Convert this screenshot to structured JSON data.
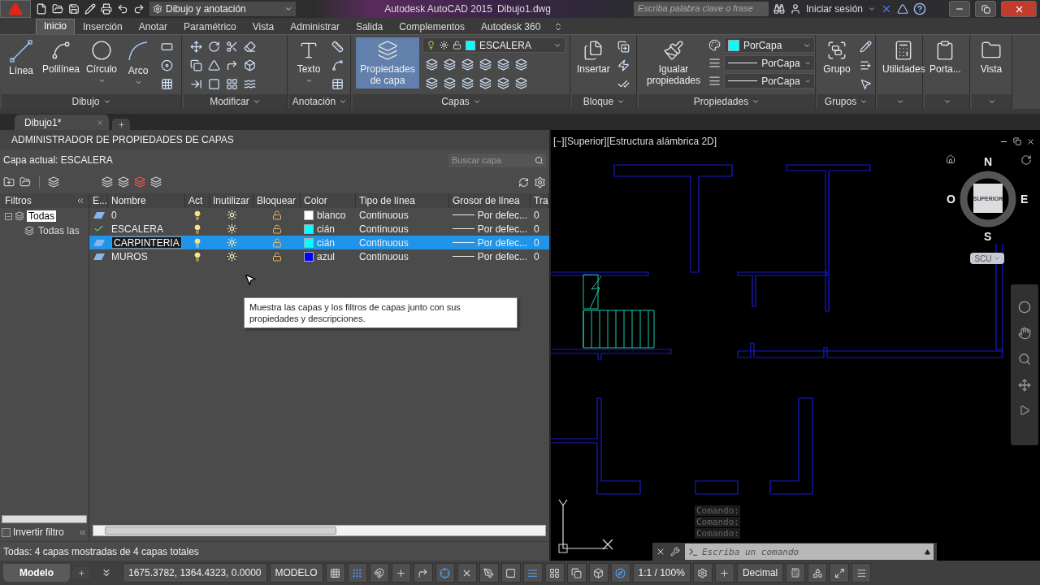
{
  "title_bar": {
    "workspace": "Dibujo y anotación",
    "app_title": "Autodesk AutoCAD 2015",
    "file_name": "Dibujo1.dwg",
    "search_placeholder": "Escriba palabra clave o frase",
    "sign_in": "Iniciar sesión"
  },
  "ribbon_tabs": [
    {
      "label": "Inicio",
      "selected": true
    },
    {
      "label": "Inserción",
      "selected": false
    },
    {
      "label": "Anotar",
      "selected": false
    },
    {
      "label": "Paramétrico",
      "selected": false
    },
    {
      "label": "Vista",
      "selected": false
    },
    {
      "label": "Administrar",
      "selected": false
    },
    {
      "label": "Salida",
      "selected": false
    },
    {
      "label": "Complementos",
      "selected": false
    },
    {
      "label": "Autodesk 360",
      "selected": false
    }
  ],
  "ribbon_panels": [
    {
      "title": "Dibujo",
      "tools": [
        {
          "label": "Línea",
          "active": false,
          "dropdown": false
        },
        {
          "label": "Polilínea",
          "active": false,
          "dropdown": false
        },
        {
          "label": "Círculo",
          "active": false,
          "dropdown": true
        },
        {
          "label": "Arco",
          "active": false,
          "dropdown": true
        }
      ]
    },
    {
      "title": "Modificar"
    },
    {
      "title": "Anotación",
      "tools": [
        {
          "label": "Texto",
          "active": false,
          "dropdown": true
        }
      ]
    },
    {
      "title": "Capas",
      "tools": [
        {
          "label": "Propiedades de capa",
          "active": true,
          "dropdown": false
        }
      ],
      "layer_dropdown": {
        "value": "ESCALERA",
        "color": "#00ffff"
      }
    },
    {
      "title": "Bloque",
      "tools": [
        {
          "label": "Insertar",
          "active": false,
          "dropdown": false
        }
      ]
    },
    {
      "title": "Propiedades",
      "tools": [
        {
          "label": "Igualar propiedades",
          "active": false,
          "dropdown": false
        }
      ],
      "property_dropdowns": [
        {
          "kind": "color",
          "value": "PorCapa",
          "color": "#00ffff"
        },
        {
          "kind": "linetype",
          "value": "PorCapa"
        },
        {
          "kind": "lineweight",
          "value": "PorCapa"
        }
      ]
    },
    {
      "title": "Grupos",
      "tools": [
        {
          "label": "Grupo",
          "active": false,
          "dropdown": false
        }
      ]
    },
    {
      "tools": [
        {
          "label": "Utilidades",
          "active": false,
          "dropdown": false
        }
      ]
    },
    {
      "tools": [
        {
          "label": "Porta...",
          "active": false,
          "dropdown": false
        }
      ]
    },
    {
      "tools": [
        {
          "label": "Vista",
          "active": false,
          "dropdown": false
        }
      ]
    }
  ],
  "document_tabs": [
    {
      "label": "Dibujo1*",
      "selected": true
    }
  ],
  "layer_manager": {
    "title": "ADMINISTRADOR DE PROPIEDADES DE CAPAS",
    "current_layer": "Capa actual: ESCALERA",
    "search_placeholder": "Buscar capa",
    "filters": {
      "heading": "Filtros",
      "tree": [
        {
          "label": "Todas",
          "selected": true,
          "expanded": true,
          "children": [
            {
              "label": "Todas las",
              "selected": false
            }
          ]
        }
      ],
      "invert_filter": {
        "label": "Invertir filtro",
        "checked": false
      }
    },
    "columns": [
      "E...",
      "Nombre",
      "Act",
      "Inutilizar",
      "Bloquear",
      "Color",
      "Tipo de línea",
      "Grosor de línea",
      "Tra"
    ],
    "rows": [
      {
        "kind": "layer",
        "name": "0",
        "on": true,
        "frozen": false,
        "locked": false,
        "color": "#ffffff",
        "color_name": "blanco",
        "linetype": "Continuous",
        "lineweight": "Por defec...",
        "column_9": "0",
        "selected": false,
        "editing": false
      },
      {
        "kind": "current",
        "name": "ESCALERA",
        "on": true,
        "frozen": false,
        "locked": false,
        "color": "#00ffff",
        "color_name": "cián",
        "linetype": "Continuous",
        "lineweight": "Por defec...",
        "column_9": "0",
        "selected": false,
        "editing": false
      },
      {
        "kind": "layer",
        "name": "CARPINTERIA",
        "on": true,
        "frozen": false,
        "locked": false,
        "color": "#00ffff",
        "color_name": "cián",
        "linetype": "Continuous",
        "lineweight": "Por defec...",
        "column_9": "0",
        "selected": true,
        "editing": true
      },
      {
        "kind": "layer",
        "name": "MUROS",
        "on": true,
        "frozen": false,
        "locked": false,
        "color": "#0000ff",
        "color_name": "azul",
        "linetype": "Continuous",
        "lineweight": "Por defec...",
        "column_9": "0",
        "selected": false,
        "editing": false
      }
    ],
    "tooltip": "Muestra las capas y los filtros de capas junto con sus propiedades y descripciones.",
    "status": "Todas: 4 capas mostradas de 4 capas totales"
  },
  "viewport": {
    "label": "[−][Superior][Estructura alámbrica 2D]",
    "viewcube": {
      "face": "SUPERIOR",
      "north": "N",
      "south": "S",
      "east": "E",
      "west": "O"
    },
    "ucs_menu": "SCU",
    "command_history": [
      "Comando:",
      "Comando:",
      "Comando:"
    ],
    "command_placeholder": "Escriba un comando"
  },
  "status_bar": {
    "layout_tabs": [
      {
        "label": "Modelo",
        "selected": true
      }
    ],
    "coordinates": "1675.3782, 1364.4323, 0.0000",
    "space": "MODELO",
    "scale": "1:1 / 100%",
    "units": "Decimal"
  }
}
